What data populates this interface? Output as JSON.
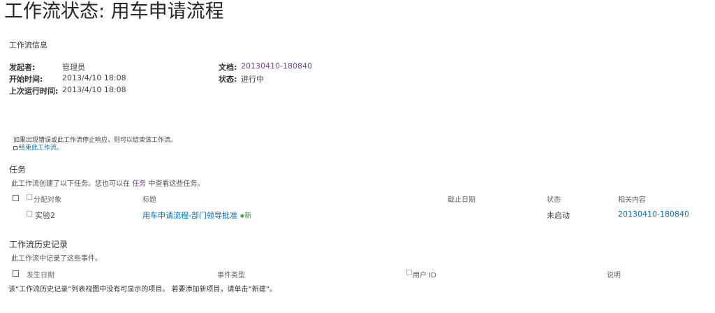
{
  "page": {
    "title": "工作流状态: 用车申请流程"
  },
  "workflow_info": {
    "heading": "工作流信息",
    "initiator_label": "发起者:",
    "initiator_value": "管理员",
    "start_label": "开始时间:",
    "start_value": "2013/4/10 18:08",
    "last_run_label": "上次运行时间:",
    "last_run_value": "2013/4/10 18:08",
    "document_label": "文档:",
    "document_value": "20130410-180840",
    "status_label": "状态:",
    "status_value": "进行中"
  },
  "terminate": {
    "notice": "如果出现错误或此工作流停止响应，则可以结束该工作流。",
    "link": "结束此工作流。"
  },
  "tasks": {
    "heading": "任务",
    "description_before": "此工作流创建了以下任务。您也可以在",
    "description_link": "任务",
    "description_after": "中查看这些任务。",
    "columns": {
      "assigned": "分配对象",
      "title": "标题",
      "due": "截止日期",
      "status": "状态",
      "related": "相关内容"
    },
    "rows": [
      {
        "assigned": "实验2",
        "title": "用车申请流程-部门领导批准",
        "new_badge": "新",
        "due": "",
        "status": "未启动",
        "related": "20130410-180840"
      }
    ]
  },
  "history": {
    "heading": "工作流历史记录",
    "description": "此工作流中记录了这些事件。",
    "columns": {
      "date": "发生日期",
      "event": "事件类型",
      "user": "用户 ID",
      "desc": "说明"
    },
    "empty_message": "该“工作流历史记录”列表视图中没有可显示的项目。 若要添加新项目，请单击“新建”。"
  },
  "colors": {
    "link": "#0072c6",
    "document_link": "#7b3f9e",
    "new_badge": "#3a8d3a"
  }
}
